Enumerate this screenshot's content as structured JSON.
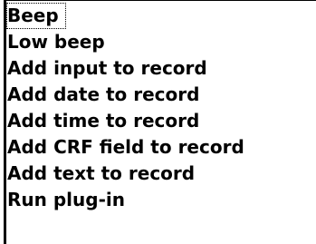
{
  "list": {
    "items": [
      {
        "label": "Beep"
      },
      {
        "label": "Low beep"
      },
      {
        "label": "Add input to record"
      },
      {
        "label": "Add date to record"
      },
      {
        "label": "Add time to record"
      },
      {
        "label": "Add CRF field to record"
      },
      {
        "label": "Add text to record"
      },
      {
        "label": "Run plug-in"
      }
    ]
  },
  "colors": {
    "background": "#ffffff",
    "text": "#000000",
    "border": "#000000"
  }
}
